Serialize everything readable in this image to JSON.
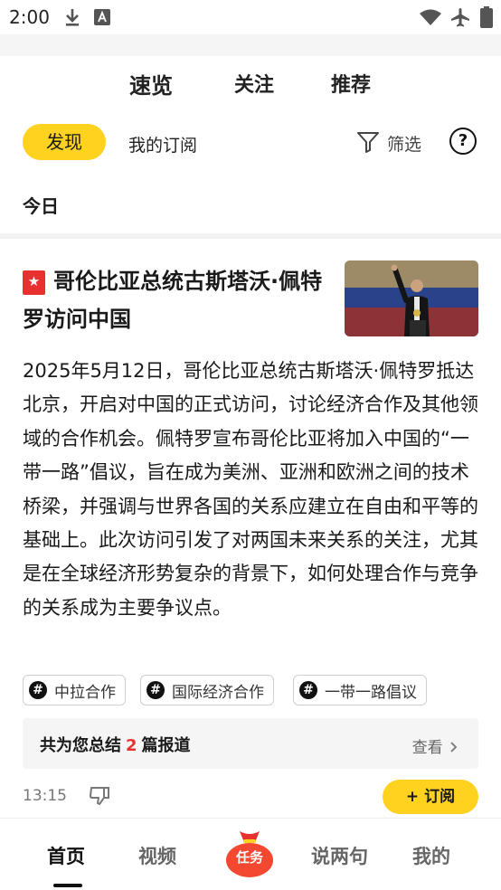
{
  "status_bar": {
    "time": "2:00"
  },
  "top_tabs": [
    {
      "label": "速览",
      "active": true
    },
    {
      "label": "关注",
      "active": false
    },
    {
      "label": "推荐",
      "active": false
    }
  ],
  "filter_row": {
    "discover_label": "发现",
    "my_subscription_label": "我的订阅",
    "filter_label": "筛选",
    "help_icon": "?"
  },
  "section_title": "今日",
  "article": {
    "title": "哥伦比亚总统古斯塔沃·佩特罗访问中国",
    "body": "2025年5月12日，哥伦比亚总统古斯塔沃·佩特罗抵达北京，开启对中国的正式访问，讨论经济合作及其他领域的合作机会。佩特罗宣布哥伦比亚将加入中国的“一带一路”倡议，旨在成为美洲、亚洲和欧洲之间的技术桥梁，并强调与世界各国的关系应建立在自由和平等的基础上。此次访问引发了对两国未来关系的关注，尤其是在全球经济形势复杂的背景下，如何处理合作与竞争的关系成为主要争议点。",
    "tags": [
      "中拉合作",
      "国际经济合作",
      "一带一路倡议"
    ],
    "summary": {
      "prefix": "共为您总结",
      "count": "2",
      "suffix": "篇报道",
      "view_label": "查看"
    },
    "time": "13:15",
    "subscribe_label": "+ 订阅"
  },
  "bottom_nav": {
    "items": [
      "首页",
      "视频",
      "说两句",
      "我的"
    ],
    "task_label": "任务",
    "active": "首页"
  },
  "colors": {
    "accent_yellow": "#ffd21f",
    "accent_red": "#e8312f"
  }
}
